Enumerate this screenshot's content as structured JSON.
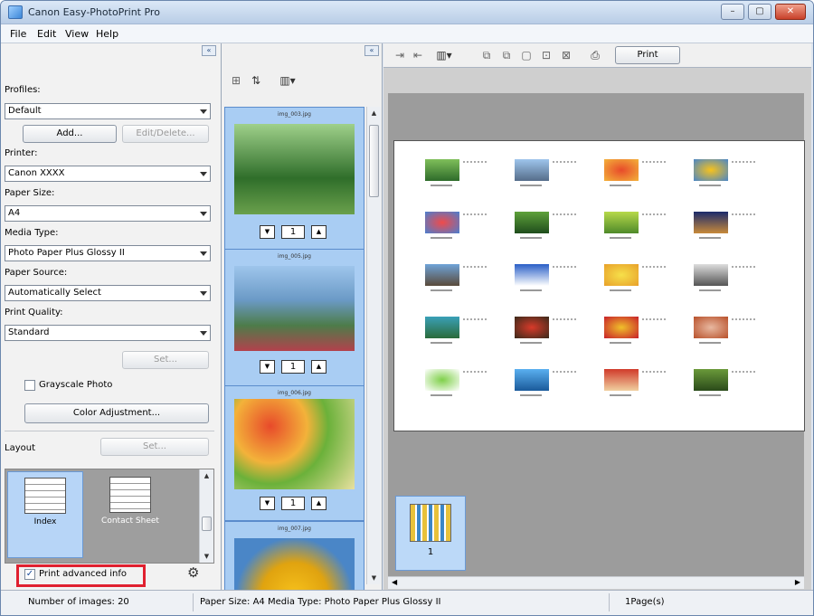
{
  "window": {
    "title": "Canon Easy-PhotoPrint Pro",
    "minimize": "–",
    "maximize": "▢",
    "close": "✕"
  },
  "menu": [
    "File",
    "Edit",
    "View",
    "Help"
  ],
  "left": {
    "collapse_glyph": "«",
    "profiles_label": "Profiles:",
    "profiles_value": "Default",
    "add_button": "Add...",
    "edit_delete_button": "Edit/Delete...",
    "printer_label": "Printer:",
    "printer_value": "Canon XXXX",
    "paper_size_label": "Paper Size:",
    "paper_size_value": "A4",
    "media_type_label": "Media Type:",
    "media_type_value": "Photo Paper Plus Glossy II",
    "paper_source_label": "Paper Source:",
    "paper_source_value": "Automatically Select",
    "print_quality_label": "Print Quality:",
    "print_quality_value": "Standard",
    "set_button": "Set...",
    "grayscale_label": "Grayscale Photo",
    "grayscale_checked": false,
    "color_adjust_button": "Color Adjustment...",
    "layout_label": "Layout",
    "layout_set_button": "Set...",
    "layouts": [
      {
        "label": "Index",
        "selected": true
      },
      {
        "label": "Contact Sheet",
        "selected": false
      }
    ],
    "advanced_info_label": "Print advanced info",
    "advanced_info_checked": true
  },
  "middle": {
    "collapse_glyph": "«",
    "images": [
      {
        "file": "img_003.jpg",
        "count": "1"
      },
      {
        "file": "img_005.jpg",
        "count": "1"
      },
      {
        "file": "img_006.jpg",
        "count": "1"
      },
      {
        "file": "img_007.jpg",
        "count": ""
      }
    ]
  },
  "right": {
    "print_button": "Print",
    "page_label": "1"
  },
  "status": {
    "num_images": "Number of images: 20",
    "paper_info": "Paper Size: A4 Media Type: Photo Paper Plus Glossy II",
    "pages": "1Page(s)"
  },
  "colors": {
    "selection": "#a9cdf3",
    "highlight": "#e0202f"
  }
}
